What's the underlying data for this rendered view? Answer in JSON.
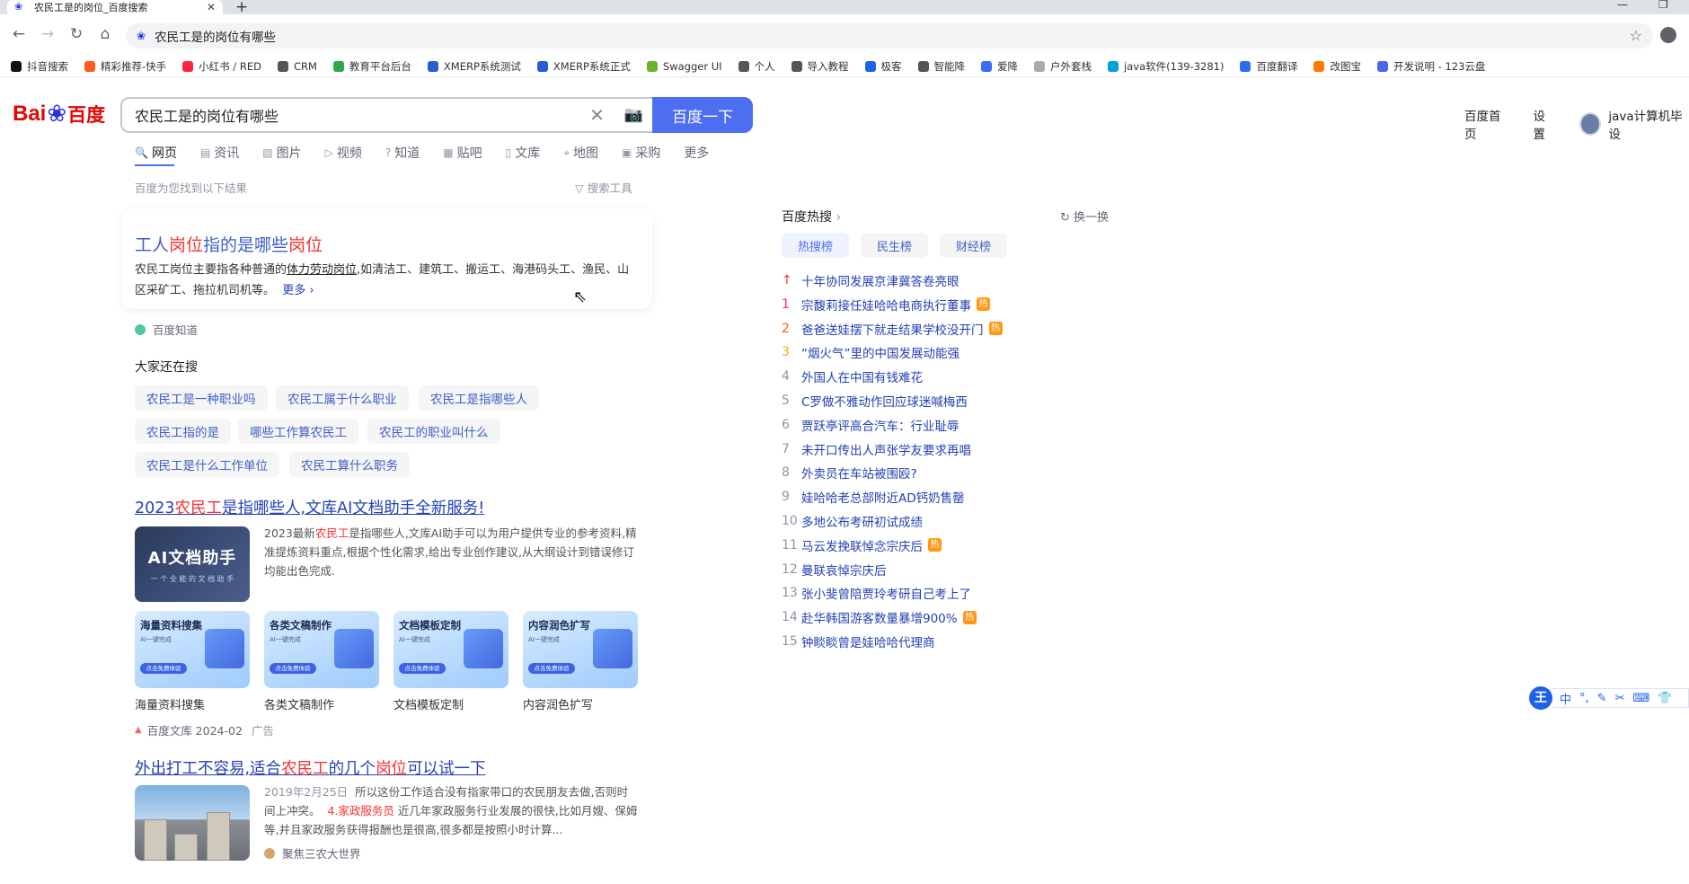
{
  "browser": {
    "tab_title": "农民工是的岗位_百度搜索",
    "address": "农民工是的岗位有哪些",
    "bookmarks": [
      {
        "label": "抖音搜索",
        "color": "#111111"
      },
      {
        "label": "精彩推荐-快手",
        "color": "#ff5a1f"
      },
      {
        "label": "小红书 / RED",
        "color": "#ff2442"
      },
      {
        "label": "CRM",
        "color": "#555555"
      },
      {
        "label": "教育平台后台",
        "color": "#2fa84f"
      },
      {
        "label": "XMERP系统测试",
        "color": "#2b5cd6"
      },
      {
        "label": "XMERP系统正式",
        "color": "#2b5cd6"
      },
      {
        "label": "Swagger UI",
        "color": "#6bb42c"
      },
      {
        "label": "个人",
        "color": "#555555"
      },
      {
        "label": "导入教程",
        "color": "#555555"
      },
      {
        "label": "极客",
        "color": "#1e62e8"
      },
      {
        "label": "智能降",
        "color": "#555555"
      },
      {
        "label": "爱降",
        "color": "#3a6df0"
      },
      {
        "label": "户外套栈",
        "color": "#aaaaaa"
      },
      {
        "label": "java软件(139-3281)",
        "color": "#00a1d6"
      },
      {
        "label": "百度翻译",
        "color": "#2b6ef2"
      },
      {
        "label": "改图宝",
        "color": "#ff7a00"
      },
      {
        "label": "开发说明 - 123云盘",
        "color": "#4f66e8"
      }
    ]
  },
  "header": {
    "logo_bai": "Bai",
    "logo_du": "百度",
    "query": "农民工是的岗位有哪些",
    "search_button": "百度一下",
    "links": [
      "百度首页",
      "设置"
    ],
    "username": "java计算机毕设"
  },
  "tabs": [
    "网页",
    "资讯",
    "图片",
    "视频",
    "知道",
    "贴吧",
    "文库",
    "地图",
    "采购",
    "更多"
  ],
  "found_text": "百度为您找到以下结果",
  "search_tools": "搜索工具",
  "result1": {
    "title_parts": [
      "工人",
      "岗位",
      "指的是哪些",
      "岗位"
    ],
    "abstract_a": "农民工岗位主要指各种普通的",
    "abstract_hl": "体力劳动岗位",
    "abstract_b": ",如清洁工、建筑工、搬运工、海港码头工、渔民、山区采矿工、拖拉机司机等。",
    "more": "更多",
    "source": "百度知道"
  },
  "also_search": {
    "title": "大家还在搜",
    "chips": [
      "农民工是一种职业吗",
      "农民工属于什么职业",
      "农民工是指哪些人",
      "农民工指的是",
      "哪些工作算农民工",
      "农民工的职业叫什么",
      "农民工是什么工作单位",
      "农民工算什么职务"
    ]
  },
  "result2": {
    "title_a": "2023",
    "title_hl": "农民工",
    "title_b": "是指哪些人,文库AI文档助手全新服务!",
    "thumb_big": "AI文档助手",
    "thumb_small": "一 个 全 能 的 文 档 助 手",
    "abstract_a": "2023最新",
    "abstract_hl": "农民工",
    "abstract_b": "是指哪些人,文库AI助手可以为用户提供专业的参考资料,精准提炼资料重点,根据个性化需求,给出专业创作建议,从大纲设计到错误修订均能出色完成.",
    "features": [
      {
        "title": "海量资料搜集",
        "sub": "AI一键完成",
        "btn": "点击免费体验"
      },
      {
        "title": "各类文稿制作",
        "sub": "AI一键完成",
        "btn": "点击免费体验"
      },
      {
        "title": "文档模板定制",
        "sub": "AI一键完成",
        "btn": "点击免费体验"
      },
      {
        "title": "内容润色扩写",
        "sub": "AI一键完成",
        "btn": "点击免费体验"
      }
    ],
    "source": "百度文库 2024-02",
    "ad": "广告"
  },
  "result3": {
    "title_a": "外出打工不容易,适合",
    "title_hl1": "农民工",
    "title_b": "的几个",
    "title_hl2": "岗位",
    "title_c": "可以试一下",
    "date": "2019年2月25日",
    "abstract_a": "所以这份工作适合没有指家带口的农民朋友去做,否则时间上冲突。",
    "abstract_hl": "4.家政服务员",
    "abstract_b": "近几年家政服务行业发展的很快,比如月嫂、保姆等,并且家政服务获得报酬也是很高,很多都是按照小时计算...",
    "source": "聚焦三农大世界"
  },
  "hot": {
    "title": "百度热搜",
    "refresh": "换一换",
    "tabs": [
      "热搜榜",
      "民生榜",
      "财经榜"
    ],
    "items": [
      {
        "rank": "↑",
        "text": "十年协同发展京津冀答卷亮眼",
        "hot": false
      },
      {
        "rank": "1",
        "text": "宗馥莉接任娃哈哈电商执行董事",
        "hot": true
      },
      {
        "rank": "2",
        "text": "爸爸送娃摆下就走结果学校没开门",
        "hot": true
      },
      {
        "rank": "3",
        "text": "“烟火气”里的中国发展动能强",
        "hot": false
      },
      {
        "rank": "4",
        "text": "外国人在中国有钱难花",
        "hot": false
      },
      {
        "rank": "5",
        "text": "C罗做不雅动作回应球迷喊梅西",
        "hot": false
      },
      {
        "rank": "6",
        "text": "贾跃亭评高合汽车：行业耻辱",
        "hot": false
      },
      {
        "rank": "7",
        "text": "未开口传出人声张学友要求再唱",
        "hot": false
      },
      {
        "rank": "8",
        "text": "外卖员在车站被围殴?",
        "hot": false
      },
      {
        "rank": "9",
        "text": "娃哈哈老总部附近AD钙奶售罄",
        "hot": false
      },
      {
        "rank": "10",
        "text": "多地公布考研初试成绩",
        "hot": false
      },
      {
        "rank": "11",
        "text": "马云发挽联悼念宗庆后",
        "hot": true
      },
      {
        "rank": "12",
        "text": "曼联哀悼宗庆后",
        "hot": false
      },
      {
        "rank": "13",
        "text": "张小斐曾陪贾玲考研自己考上了",
        "hot": false
      },
      {
        "rank": "14",
        "text": "赴华韩国游客数量暴增900%",
        "hot": true
      },
      {
        "rank": "15",
        "text": "钟睒睒曾是娃哈哈代理商",
        "hot": false
      }
    ],
    "hot_badge": "热"
  },
  "ime": {
    "logo": "王",
    "items": [
      "中",
      "°,",
      "✎",
      "✂",
      "⌨",
      "👕"
    ]
  }
}
